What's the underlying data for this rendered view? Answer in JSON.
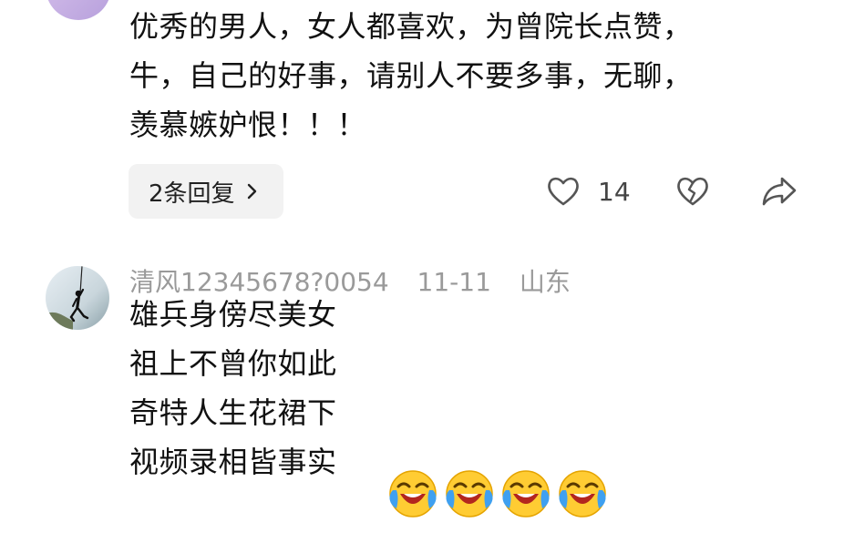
{
  "comments": [
    {
      "lines": [
        "优秀的男人，女人都喜欢，为曾院长点赞，",
        "牛，自己的好事，请别人不要多事，无聊，",
        "羡慕嫉妒恨！！！"
      ],
      "reply_label": "2条回复",
      "like_count": "14",
      "icons": [
        "chevron-right-icon",
        "heart-icon",
        "broken-heart-icon",
        "share-icon"
      ]
    },
    {
      "username": "清风12345678?0054",
      "date": "11-11",
      "location": "山东",
      "lines": [
        "雄兵身傍尽美女",
        "祖上不曾你如此",
        "奇特人生花裙下",
        "视频录相皆事实"
      ],
      "emojis": [
        "laughing-crying-emoji",
        "laughing-crying-emoji",
        "laughing-crying-emoji",
        "laughing-crying-emoji"
      ]
    }
  ],
  "colors": {
    "meta_gray": "#9a9a9a",
    "chip_bg": "#f2f2f2",
    "icon_gray": "#555555"
  }
}
